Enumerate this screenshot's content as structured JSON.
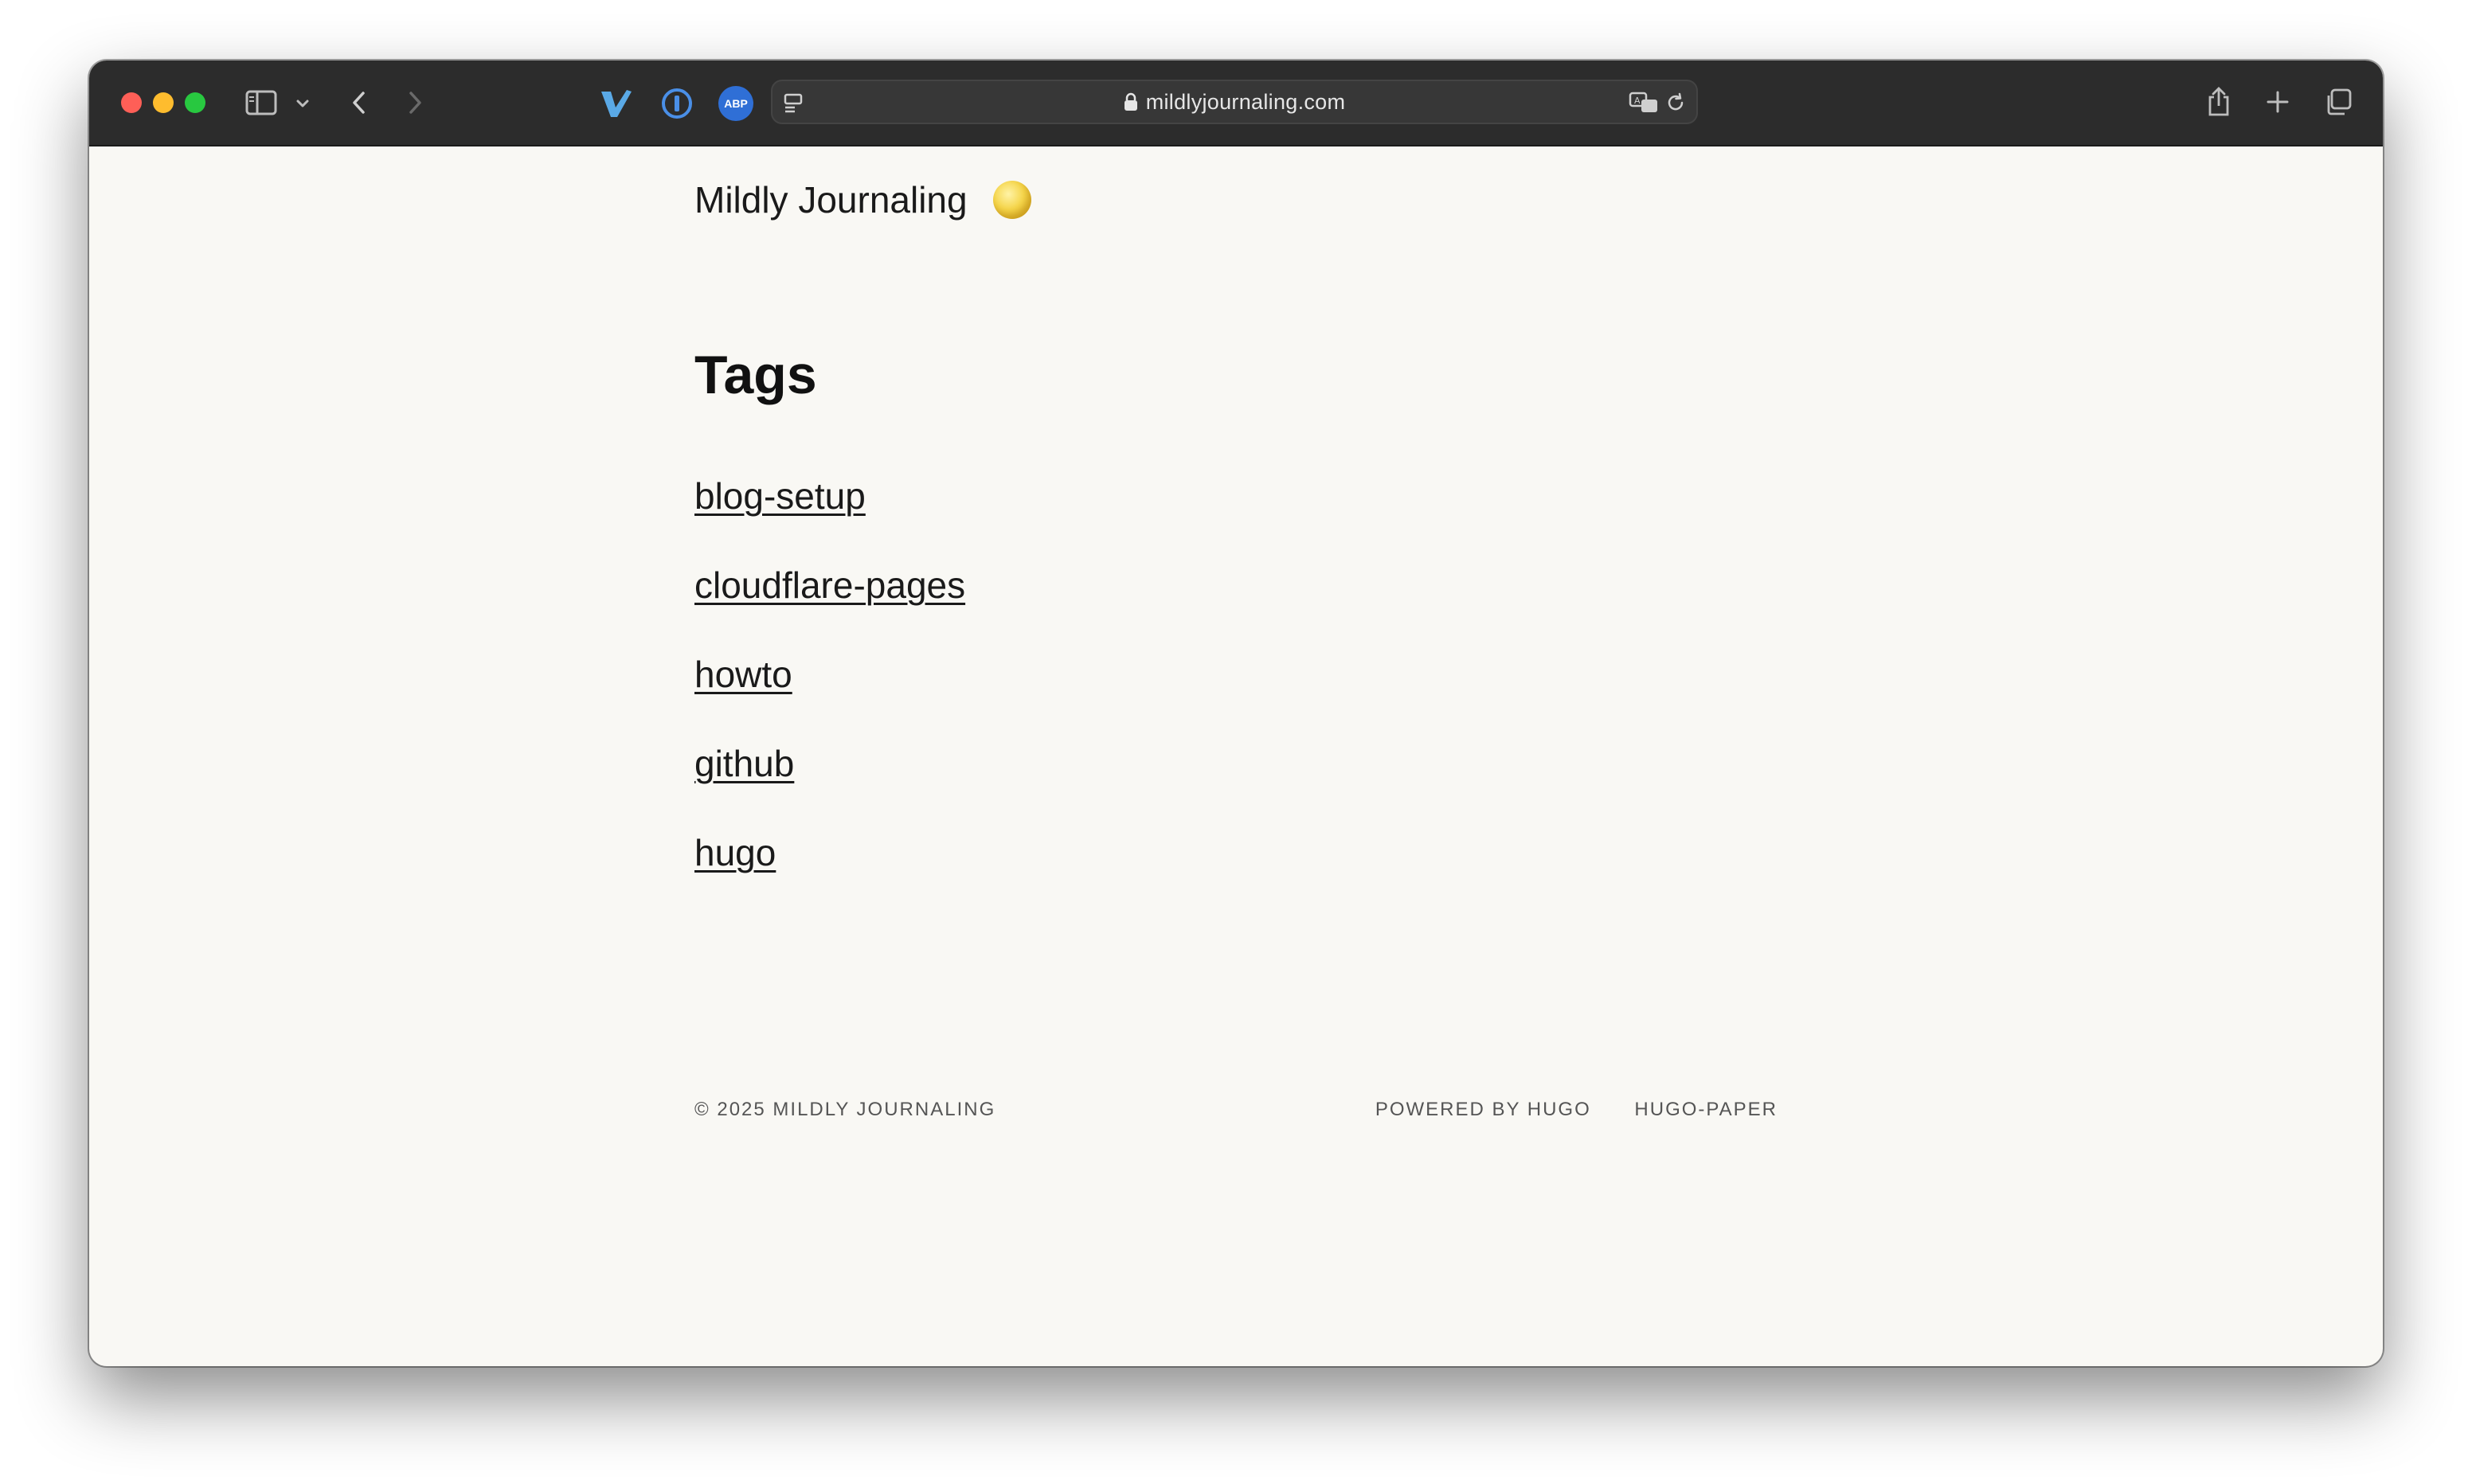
{
  "browser": {
    "url": "mildlyjournaling.com",
    "colors": {
      "toolbar": "#2c2c2c",
      "close": "#fe5f57",
      "minimize": "#febc2e",
      "zoom": "#28c840",
      "extension_abp": "#2f6fd6"
    },
    "extensions": {
      "abp_label": "ABP"
    }
  },
  "site": {
    "title": "Mildly Journaling",
    "theme_icon": "moon-icon"
  },
  "page": {
    "heading": "Tags",
    "tags": [
      "blog-setup",
      "cloudflare-pages",
      "howto",
      "github",
      "hugo"
    ]
  },
  "footer": {
    "copyright": "© 2025 MILDLY JOURNALING",
    "powered_by": "POWERED BY HUGO",
    "theme": "HUGO-PAPER"
  }
}
